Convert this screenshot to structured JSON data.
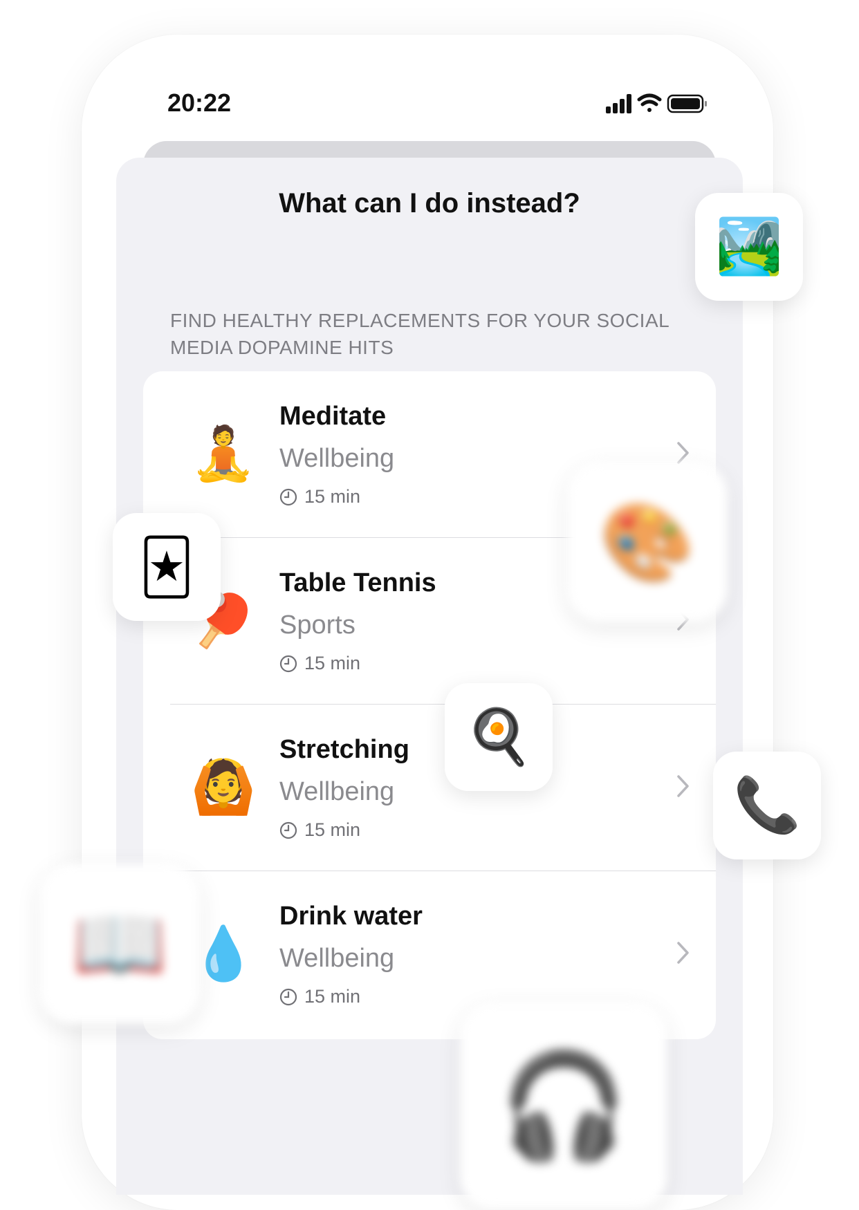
{
  "status_bar": {
    "time": "20:22"
  },
  "sheet": {
    "title": "What can I do instead?",
    "section_header": "FIND HEALTHY REPLACEMENTS FOR YOUR SOCIAL MEDIA DOPAMINE HITS"
  },
  "activities": [
    {
      "emoji": "🧘",
      "title": "Meditate",
      "category": "Wellbeing",
      "duration": "15 min"
    },
    {
      "emoji": "🏓",
      "title": "Table Tennis",
      "category": "Sports",
      "duration": "15 min"
    },
    {
      "emoji": "🙆",
      "title": "Stretching",
      "category": "Wellbeing",
      "duration": "15 min"
    },
    {
      "emoji": "💧",
      "title": "Drink water",
      "category": "Wellbeing",
      "duration": "15 min"
    }
  ],
  "floating_icons": {
    "picture": "🏞️",
    "palette": "🎨",
    "joker": "🃏",
    "cooking": "🍳",
    "phone": "📞",
    "book": "📖",
    "headphones": "🎧"
  }
}
